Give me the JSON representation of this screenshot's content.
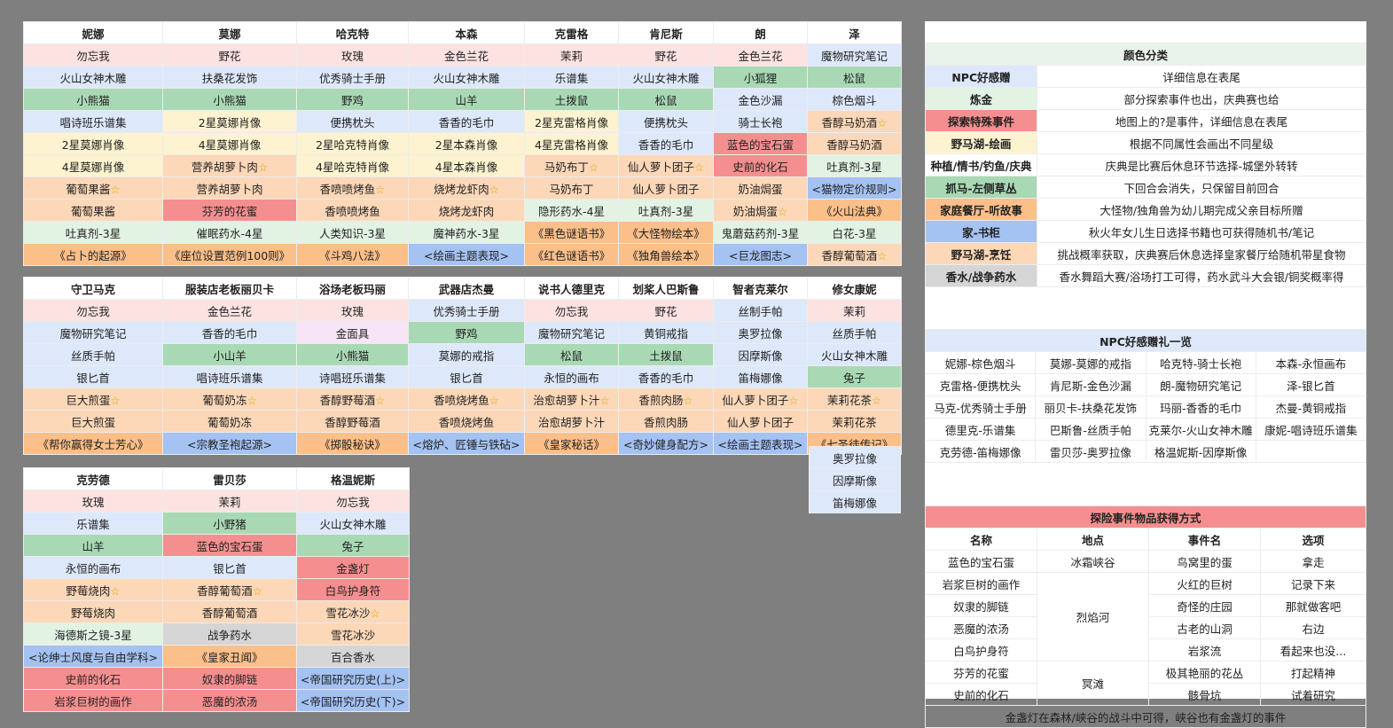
{
  "colors": {
    "pink": "#fde2e2",
    "blue": "#dde8fb",
    "green": "#a8d9b4",
    "yellow": "#fdf3d0",
    "peach": "#fcd7b8",
    "orange": "#fbbf8a",
    "red": "#f58f8f",
    "lgreen": "#e2f3e4",
    "lav": "#f8e4f7",
    "gray": "#d5d5d5",
    "cobalt": "#a4c2f2",
    "background": "#7f7f7f"
  },
  "icons": {
    "star": "star-icon"
  },
  "table1": {
    "headers": [
      "妮娜",
      "莫娜",
      "哈克特",
      "本森",
      "克雷格",
      "肯尼斯",
      "朗",
      "泽"
    ],
    "rows": [
      [
        [
          "勿忘我",
          "pink"
        ],
        [
          "野花",
          "pink"
        ],
        [
          "玫瑰",
          "pink"
        ],
        [
          "金色兰花",
          "pink"
        ],
        [
          "茉莉",
          "pink"
        ],
        [
          "野花",
          "pink"
        ],
        [
          "金色兰花",
          "pink"
        ],
        [
          "魔物研究笔记",
          "blue"
        ]
      ],
      [
        [
          "火山女神木雕",
          "blue"
        ],
        [
          "扶桑花发饰",
          "blue"
        ],
        [
          "优秀骑士手册",
          "blue"
        ],
        [
          "火山女神木雕",
          "blue"
        ],
        [
          "乐谱集",
          "blue"
        ],
        [
          "火山女神木雕",
          "blue"
        ],
        [
          "小狐狸",
          "green"
        ],
        [
          "松鼠",
          "green"
        ]
      ],
      [
        [
          "小熊猫",
          "green"
        ],
        [
          "小熊猫",
          "green"
        ],
        [
          "野鸡",
          "green"
        ],
        [
          "山羊",
          "green"
        ],
        [
          "土拨鼠",
          "green"
        ],
        [
          "松鼠",
          "green"
        ],
        [
          "金色沙漏",
          "blue"
        ],
        [
          "棕色烟斗",
          "blue"
        ]
      ],
      [
        [
          "唱诗班乐谱集",
          "blue"
        ],
        [
          "2星莫娜肖像",
          "yellow"
        ],
        [
          "便携枕头",
          "blue"
        ],
        [
          "香香的毛巾",
          "blue"
        ],
        [
          "2星克雷格肖像",
          "yellow"
        ],
        [
          "便携枕头",
          "blue"
        ],
        [
          "骑士长袍",
          "blue"
        ],
        [
          "香醇马奶酒",
          "peach",
          true
        ]
      ],
      [
        [
          "2星莫娜肖像",
          "yellow"
        ],
        [
          "4星莫娜肖像",
          "yellow"
        ],
        [
          "2星哈克特肖像",
          "yellow"
        ],
        [
          "2星本森肖像",
          "yellow"
        ],
        [
          "4星克雷格肖像",
          "yellow"
        ],
        [
          "香香的毛巾",
          "blue"
        ],
        [
          "蓝色的宝石蛋",
          "red"
        ],
        [
          "香醇马奶酒",
          "peach"
        ]
      ],
      [
        [
          "4星莫娜肖像",
          "yellow"
        ],
        [
          "营养胡萝卜肉",
          "peach",
          true
        ],
        [
          "4星哈克特肖像",
          "yellow"
        ],
        [
          "4星本森肖像",
          "yellow"
        ],
        [
          "马奶布丁",
          "peach",
          true
        ],
        [
          "仙人萝卜团子",
          "peach",
          true
        ],
        [
          "史前的化石",
          "red"
        ],
        [
          "吐真剂-3星",
          "lgreen"
        ]
      ],
      [
        [
          "葡萄果酱",
          "peach",
          true
        ],
        [
          "营养胡萝卜肉",
          "peach"
        ],
        [
          "香喷喷烤鱼",
          "peach",
          true
        ],
        [
          "烧烤龙虾肉",
          "peach",
          true
        ],
        [
          "马奶布丁",
          "peach"
        ],
        [
          "仙人萝卜团子",
          "peach"
        ],
        [
          "奶油焗蛋",
          "peach"
        ],
        [
          "<猫物定价规则>",
          "cobalt"
        ]
      ],
      [
        [
          "葡萄果酱",
          "peach"
        ],
        [
          "芬芳的花蜜",
          "red"
        ],
        [
          "香喷喷烤鱼",
          "peach"
        ],
        [
          "烧烤龙虾肉",
          "peach"
        ],
        [
          "隐形药水-4星",
          "lgreen"
        ],
        [
          "吐真剂-3星",
          "lgreen"
        ],
        [
          "奶油焗蛋",
          "peach",
          true
        ],
        [
          "《火山法典》",
          "orange"
        ]
      ],
      [
        [
          "吐真剂-3星",
          "lgreen"
        ],
        [
          "催眠药水-4星",
          "lgreen"
        ],
        [
          "人类知识-3星",
          "lgreen"
        ],
        [
          "魔神药水-3星",
          "lgreen"
        ],
        [
          "《黑色谜语书》",
          "orange"
        ],
        [
          "《大怪物绘本》",
          "orange"
        ],
        [
          "鬼蘑菇药剂-3星",
          "lgreen"
        ],
        [
          "白花-3星",
          "lgreen"
        ]
      ],
      [
        [
          "《占卜的起源》",
          "orange"
        ],
        [
          "《座位设置范例100则》",
          "orange"
        ],
        [
          "《斗鸡八法》",
          "orange"
        ],
        [
          "<绘画主题表现>",
          "cobalt"
        ],
        [
          "《红色谜语书》",
          "orange"
        ],
        [
          "《独角兽绘本》",
          "orange"
        ],
        [
          "<巨龙图志>",
          "cobalt"
        ],
        [
          "香醇葡萄酒",
          "peach",
          true
        ]
      ]
    ]
  },
  "table2": {
    "headers": [
      "守卫马克",
      "服装店老板丽贝卡",
      "浴场老板玛丽",
      "武器店杰曼",
      "说书人德里克",
      "划桨人巴斯鲁",
      "智者克莱尔",
      "修女康妮"
    ],
    "rows": [
      [
        [
          "勿忘我",
          "pink"
        ],
        [
          "金色兰花",
          "pink"
        ],
        [
          "玫瑰",
          "pink"
        ],
        [
          "优秀骑士手册",
          "blue"
        ],
        [
          "勿忘我",
          "pink"
        ],
        [
          "野花",
          "pink"
        ],
        [
          "丝制手帕",
          "blue"
        ],
        [
          "茉莉",
          "pink"
        ]
      ],
      [
        [
          "魔物研究笔记",
          "blue"
        ],
        [
          "香香的毛巾",
          "blue"
        ],
        [
          "金面具",
          "lav"
        ],
        [
          "野鸡",
          "green"
        ],
        [
          "魔物研究笔记",
          "blue"
        ],
        [
          "黄铜戒指",
          "blue"
        ],
        [
          "奥罗拉像",
          "blue"
        ],
        [
          "丝质手帕",
          "blue"
        ]
      ],
      [
        [
          "丝质手帕",
          "blue"
        ],
        [
          "小山羊",
          "green"
        ],
        [
          "小熊猫",
          "green"
        ],
        [
          "莫娜的戒指",
          "blue"
        ],
        [
          "松鼠",
          "green"
        ],
        [
          "土拨鼠",
          "green"
        ],
        [
          "因摩斯像",
          "blue"
        ],
        [
          "火山女神木雕",
          "blue"
        ]
      ],
      [
        [
          "银匕首",
          "blue"
        ],
        [
          "唱诗班乐谱集",
          "blue"
        ],
        [
          "诗唱班乐谱集",
          "blue"
        ],
        [
          "银匕首",
          "blue"
        ],
        [
          "永恒的画布",
          "blue"
        ],
        [
          "香香的毛巾",
          "blue"
        ],
        [
          "笛梅娜像",
          "blue"
        ],
        [
          "兔子",
          "green"
        ]
      ],
      [
        [
          "巨大煎蛋",
          "peach",
          true
        ],
        [
          "葡萄奶冻",
          "peach",
          true
        ],
        [
          "香醇野莓酒",
          "peach",
          true
        ],
        [
          "香喷烧烤鱼",
          "peach",
          true
        ],
        [
          "治愈胡萝卜汁",
          "peach",
          true
        ],
        [
          "香煎肉肠",
          "peach",
          true
        ],
        [
          "仙人萝卜团子",
          "peach",
          true
        ],
        [
          "茉莉花茶",
          "peach",
          true
        ]
      ],
      [
        [
          "巨大煎蛋",
          "peach"
        ],
        [
          "葡萄奶冻",
          "peach"
        ],
        [
          "香醇野莓酒",
          "peach"
        ],
        [
          "香喷烧烤鱼",
          "peach"
        ],
        [
          "治愈胡萝卜汁",
          "peach"
        ],
        [
          "香煎肉肠",
          "peach"
        ],
        [
          "仙人萝卜团子",
          "peach"
        ],
        [
          "茉莉花茶",
          "peach"
        ]
      ],
      [
        [
          "《帮你赢得女士芳心》",
          "orange"
        ],
        [
          "<宗教圣袍起源>",
          "cobalt"
        ],
        [
          "《掷骰秘诀》",
          "orange"
        ],
        [
          "<熔炉、匠锤与铁砧>",
          "cobalt"
        ],
        [
          "《皇家秘话》",
          "orange"
        ],
        [
          "<奇妙健身配方>",
          "cobalt"
        ],
        [
          "<绘画主题表现>",
          "cobalt"
        ],
        [
          "《七圣徒传记》",
          "orange"
        ]
      ]
    ],
    "extra": [
      "奥罗拉像",
      "因摩斯像",
      "笛梅娜像"
    ]
  },
  "table3": {
    "headers": [
      "克劳德",
      "雷贝莎",
      "格温妮斯"
    ],
    "rows": [
      [
        [
          "玫瑰",
          "pink"
        ],
        [
          "茉莉",
          "pink"
        ],
        [
          "勿忘我",
          "pink"
        ]
      ],
      [
        [
          "乐谱集",
          "blue"
        ],
        [
          "小野猪",
          "green"
        ],
        [
          "火山女神木雕",
          "blue"
        ]
      ],
      [
        [
          "山羊",
          "green"
        ],
        [
          "蓝色的宝石蛋",
          "red"
        ],
        [
          "兔子",
          "green"
        ]
      ],
      [
        [
          "永恒的画布",
          "blue"
        ],
        [
          "银匕首",
          "blue"
        ],
        [
          "金盏灯",
          "red"
        ]
      ],
      [
        [
          "野莓烧肉",
          "peach",
          true
        ],
        [
          "香醇葡萄酒",
          "peach",
          true
        ],
        [
          "白鸟护身符",
          "red"
        ]
      ],
      [
        [
          "野莓烧肉",
          "peach"
        ],
        [
          "香醇葡萄酒",
          "peach"
        ],
        [
          "雪花冰沙",
          "peach",
          true
        ]
      ],
      [
        [
          "海德斯之镜-3星",
          "lgreen"
        ],
        [
          "战争药水",
          "gray"
        ],
        [
          "雪花冰沙",
          "peach"
        ]
      ],
      [
        [
          "<论绅士风度与自由学科>",
          "cobalt"
        ],
        [
          "《皇家丑闻》",
          "orange"
        ],
        [
          "百合香水",
          "gray"
        ]
      ],
      [
        [
          "史前的化石",
          "red"
        ],
        [
          "奴隶的脚链",
          "red"
        ],
        [
          "<帝国研究历史(上)>",
          "cobalt"
        ]
      ],
      [
        [
          "岩浆巨树的画作",
          "red"
        ],
        [
          "恶魔的浓汤",
          "red"
        ],
        [
          "<帝国研究历史(下)>",
          "cobalt"
        ]
      ]
    ]
  },
  "legend": {
    "title": "颜色分类",
    "rows": [
      [
        "NPC好感赠",
        "blue",
        "详细信息在表尾"
      ],
      [
        "炼金",
        "lgreen",
        "部分探索事件也出，庆典赛也给"
      ],
      [
        "探索特殊事件",
        "red",
        "地图上的?是事件，详细信息在表尾"
      ],
      [
        "野马湖-绘画",
        "yellow",
        "根据不同属性会画出不同星级"
      ],
      [
        "种植/情书/钓鱼/庆典",
        "white",
        "庆典是比赛后休息环节选择-城堡外转转"
      ],
      [
        "抓马-左侧草丛",
        "green",
        "下回合会消失，只保留目前回合"
      ],
      [
        "家庭餐厅-听故事",
        "orange",
        "大怪物/独角兽为幼儿期完成父亲目标所赠"
      ],
      [
        "家-书柜",
        "cobalt",
        "秋火年女儿生日选择书籍也可获得随机书/笔记"
      ],
      [
        "野马湖-烹饪",
        "peach",
        "挑战概率获取，庆典赛后休息选择皇家餐厅给随机带星食物"
      ],
      [
        "香水/战争药水",
        "gray",
        "香水舞蹈大赛/浴场打工可得，药水武斗大会银/铜奖概率得"
      ]
    ]
  },
  "npc_gifts": {
    "title": "NPC好感赠礼一览",
    "rows": [
      [
        "妮娜-棕色烟斗",
        "莫娜-莫娜的戒指",
        "哈克特-骑士长袍",
        "本森-永恒画布"
      ],
      [
        "克雷格-便携枕头",
        "肯尼斯-金色沙漏",
        "朗-魔物研究笔记",
        "泽-银匕首"
      ],
      [
        "马克-优秀骑士手册",
        "丽贝卡-扶桑花发饰",
        "玛丽-香香的毛巾",
        "杰曼-黄铜戒指"
      ],
      [
        "德里克-乐谱集",
        "巴斯鲁-丝质手帕",
        "克莱尔-火山女神木雕",
        "康妮-唱诗班乐谱集"
      ],
      [
        "克劳德-笛梅娜像",
        "雷贝莎-奥罗拉像",
        "格温妮斯-因摩斯像",
        ""
      ]
    ]
  },
  "events": {
    "title": "探险事件物品获得方式",
    "headers": [
      "名称",
      "地点",
      "事件名",
      "选项"
    ],
    "rows": [
      [
        "蓝色的宝石蛋",
        "冰霜峡谷",
        "鸟窝里的蛋",
        "拿走"
      ],
      [
        "岩浆巨树的画作",
        "",
        "火红的巨树",
        "记录下来"
      ],
      [
        "奴隶的脚链",
        "烈焰河",
        "奇怪的庄园",
        "那就做客吧"
      ],
      [
        "恶魔的浓汤",
        "",
        "古老的山洞",
        "右边"
      ],
      [
        "白鸟护身符",
        "",
        "岩浆流",
        "看起来也没..."
      ],
      [
        "芬芳的花蜜",
        "冥滩",
        "极其艳丽的花丛",
        "打起精神"
      ],
      [
        "史前的化石",
        "",
        "骸骨坑",
        "试着研究"
      ]
    ],
    "footer": "金盏灯在森林/峡谷的战斗中可得，峡谷也有金盏灯的事件"
  }
}
